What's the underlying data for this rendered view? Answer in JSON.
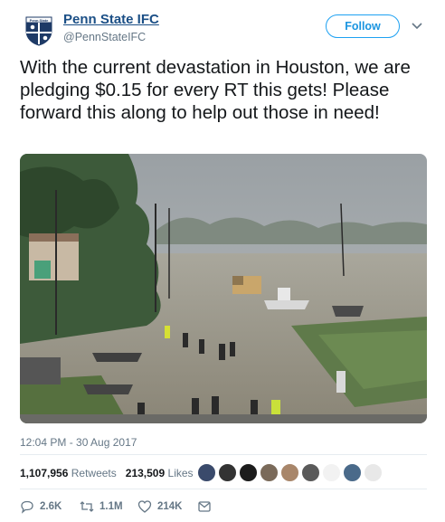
{
  "author": {
    "name": "Penn State IFC",
    "handle": "@PennStateIFC",
    "avatar_text": "Penn State"
  },
  "follow_label": "Follow",
  "tweet": {
    "text": "With the current devastation in Houston, we are pledging $0.15 for every RT this gets! Please forward this along to help out those in need!",
    "timestamp": "12:04 PM - 30 Aug 2017"
  },
  "stats": {
    "retweets_count": "1,107,956",
    "retweets_label": "Retweets",
    "likes_count": "213,509",
    "likes_label": "Likes"
  },
  "actions": {
    "reply_count": "2.6K",
    "retweet_count": "1.1M",
    "like_count": "214K"
  },
  "colors": {
    "link": "#1b4f86",
    "accent": "#1da1f2",
    "muted": "#657786"
  },
  "icons": [
    "chevron-down-icon",
    "reply-icon",
    "retweet-icon",
    "heart-icon",
    "message-icon"
  ]
}
